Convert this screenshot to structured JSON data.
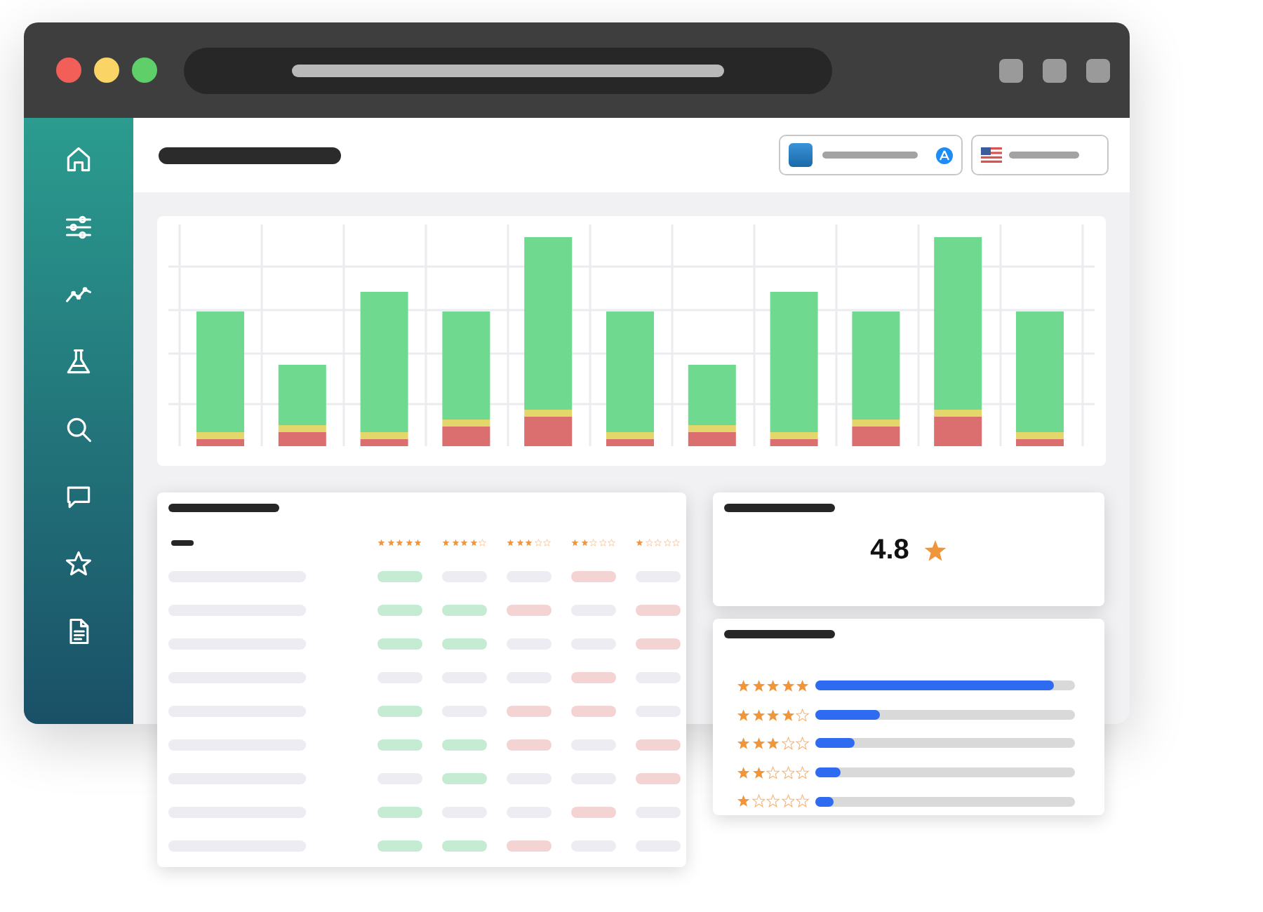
{
  "sidebar": {
    "items": [
      {
        "kind": "home"
      },
      {
        "kind": "sliders"
      },
      {
        "kind": "trend"
      },
      {
        "kind": "flask"
      },
      {
        "kind": "search"
      },
      {
        "kind": "chat"
      },
      {
        "kind": "star"
      },
      {
        "kind": "document"
      }
    ]
  },
  "table": {
    "columns": [
      {
        "stars": 5
      },
      {
        "stars": 4
      },
      {
        "stars": 3
      },
      {
        "stars": 2
      },
      {
        "stars": 1
      }
    ],
    "rows": [
      {
        "cells": [
          {
            "color": "#c5ecd3"
          },
          {
            "color": "#ececf2"
          },
          {
            "color": "#ececf2"
          },
          {
            "color": "#f4d3d3"
          },
          {
            "color": "#ececf2"
          }
        ]
      },
      {
        "cells": [
          {
            "color": "#c5ecd3"
          },
          {
            "color": "#c5ecd3"
          },
          {
            "color": "#f4d3d3"
          },
          {
            "color": "#ececf2"
          },
          {
            "color": "#f4d3d3"
          }
        ]
      },
      {
        "cells": [
          {
            "color": "#c5ecd3"
          },
          {
            "color": "#c5ecd3"
          },
          {
            "color": "#ececf2"
          },
          {
            "color": "#ececf2"
          },
          {
            "color": "#f4d3d3"
          }
        ]
      },
      {
        "cells": [
          {
            "color": "#ececf2"
          },
          {
            "color": "#ececf2"
          },
          {
            "color": "#ececf2"
          },
          {
            "color": "#f4d3d3"
          },
          {
            "color": "#ececf2"
          }
        ]
      },
      {
        "cells": [
          {
            "color": "#c5ecd3"
          },
          {
            "color": "#ececf2"
          },
          {
            "color": "#f4d3d3"
          },
          {
            "color": "#f4d3d3"
          },
          {
            "color": "#ececf2"
          }
        ]
      },
      {
        "cells": [
          {
            "color": "#c5ecd3"
          },
          {
            "color": "#c5ecd3"
          },
          {
            "color": "#f4d3d3"
          },
          {
            "color": "#ececf2"
          },
          {
            "color": "#f4d3d3"
          }
        ]
      },
      {
        "cells": [
          {
            "color": "#ececf2"
          },
          {
            "color": "#c5ecd3"
          },
          {
            "color": "#ececf2"
          },
          {
            "color": "#ececf2"
          },
          {
            "color": "#f4d3d3"
          }
        ]
      },
      {
        "cells": [
          {
            "color": "#c5ecd3"
          },
          {
            "color": "#ececf2"
          },
          {
            "color": "#ececf2"
          },
          {
            "color": "#f4d3d3"
          },
          {
            "color": "#ececf2"
          }
        ]
      },
      {
        "cells": [
          {
            "color": "#c5ecd3"
          },
          {
            "color": "#c5ecd3"
          },
          {
            "color": "#f4d3d3"
          },
          {
            "color": "#ececf2"
          },
          {
            "color": "#ececf2"
          }
        ]
      }
    ]
  },
  "rating": {
    "value": "4.8"
  },
  "distribution": [
    {
      "stars": 5,
      "level": 0.92
    },
    {
      "stars": 4,
      "level": 0.25
    },
    {
      "stars": 3,
      "level": 0.15
    },
    {
      "stars": 2,
      "level": 0.1
    },
    {
      "stars": 1,
      "level": 0.07
    }
  ]
}
